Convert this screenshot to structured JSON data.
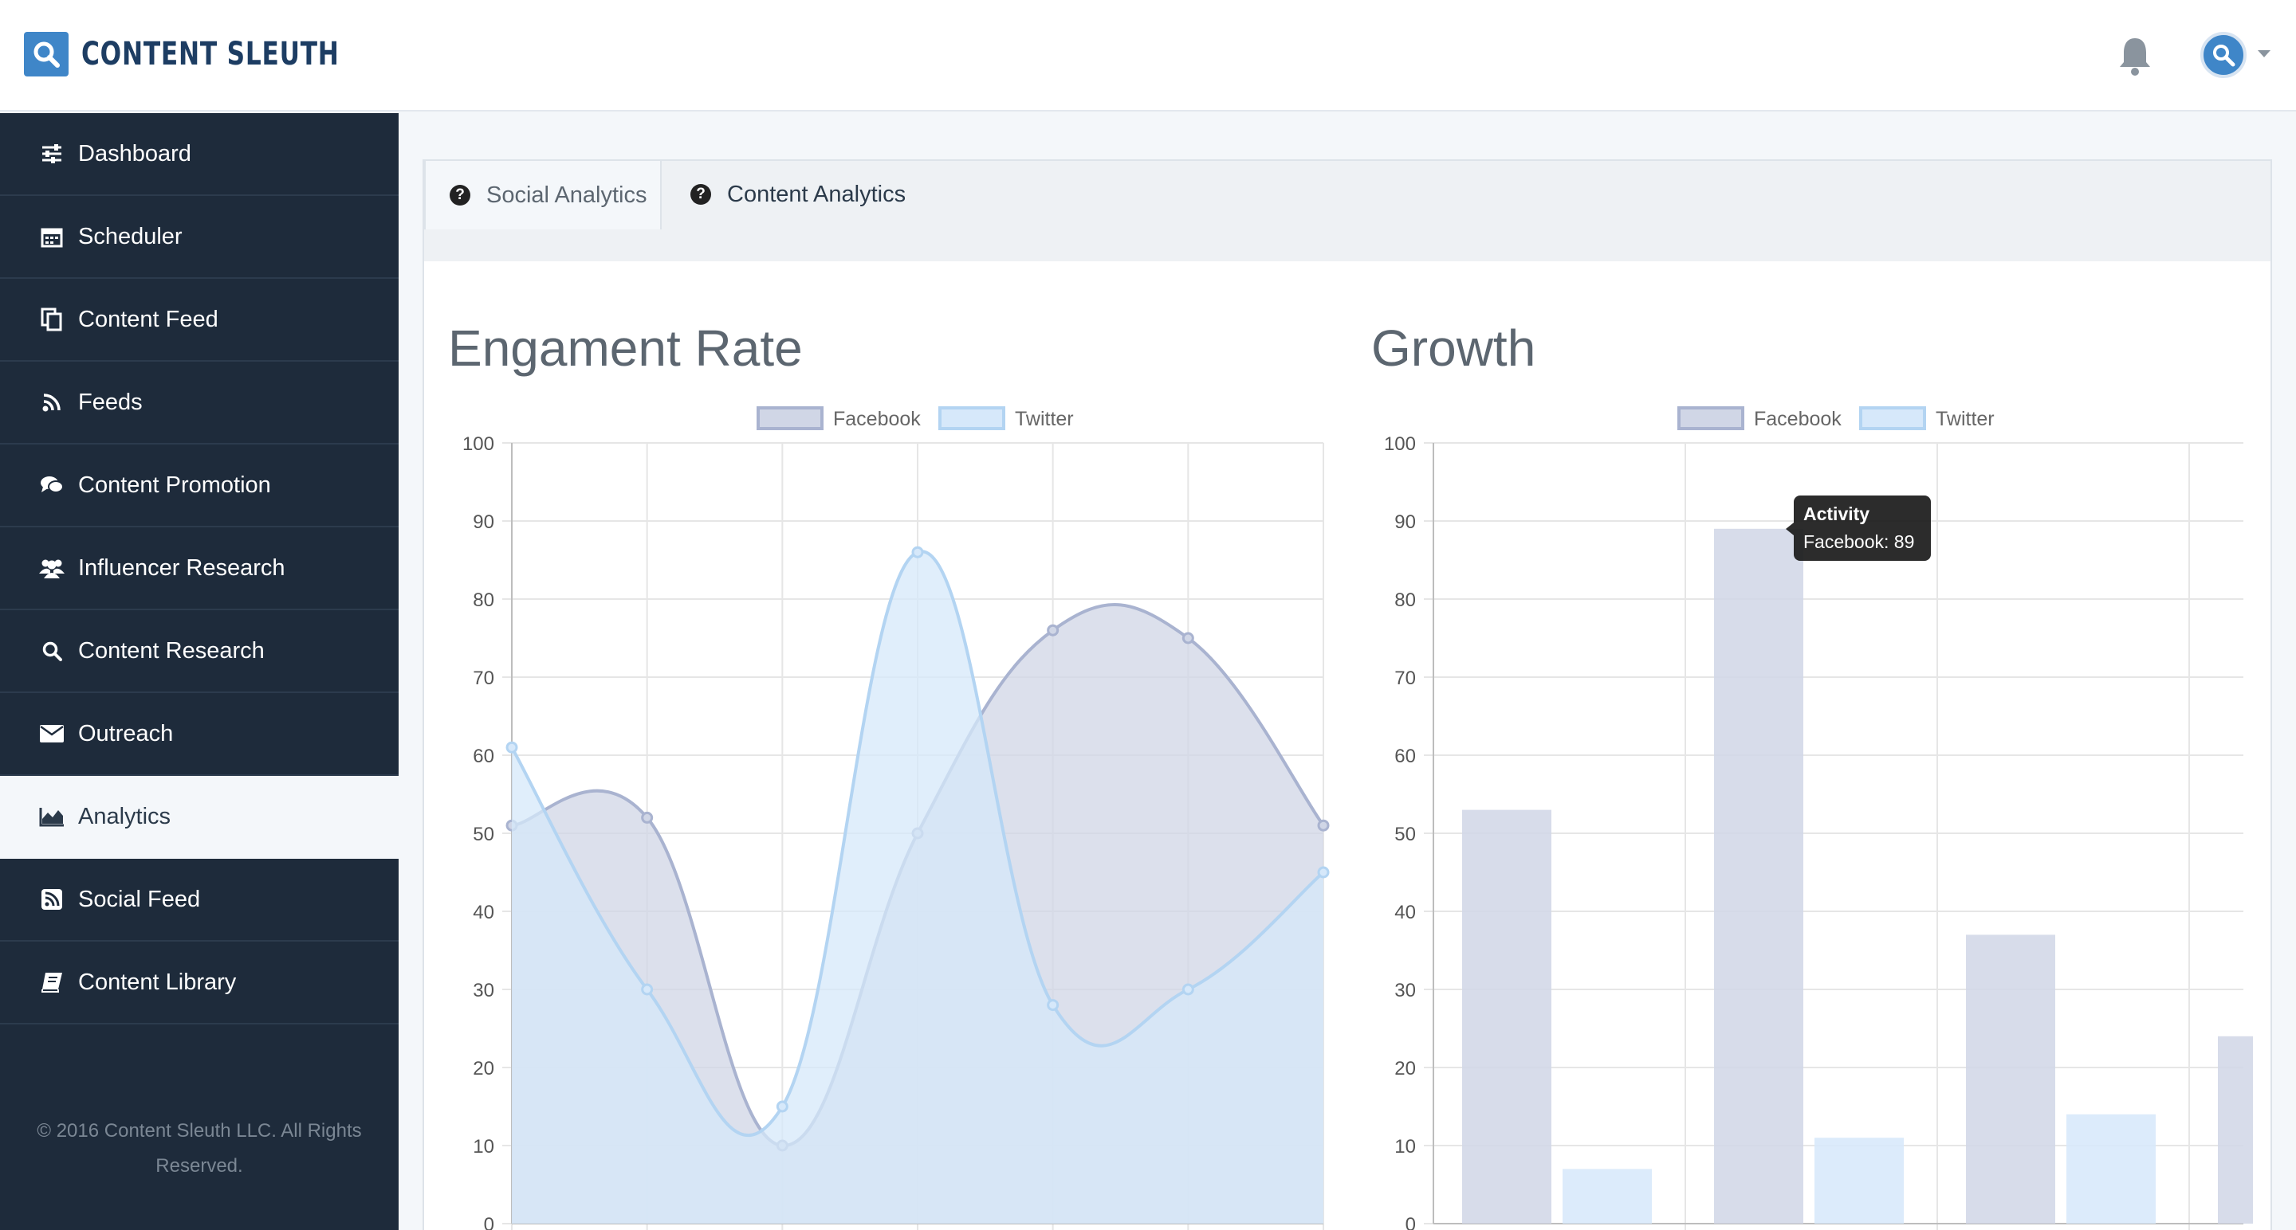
{
  "app": {
    "brand": "CONTENT SLEUTH"
  },
  "header": {
    "bell_icon": "bell-icon",
    "avatar_icon": "search-icon"
  },
  "sidebar": {
    "items": [
      {
        "label": "Dashboard",
        "icon": "sliders-icon"
      },
      {
        "label": "Scheduler",
        "icon": "calendar-icon"
      },
      {
        "label": "Content Feed",
        "icon": "copy-icon"
      },
      {
        "label": "Feeds",
        "icon": "rss-icon"
      },
      {
        "label": "Content Promotion",
        "icon": "comments-icon"
      },
      {
        "label": "Influencer Research",
        "icon": "users-icon"
      },
      {
        "label": "Content Research",
        "icon": "search-icon"
      },
      {
        "label": "Outreach",
        "icon": "envelope-icon"
      },
      {
        "label": "Analytics",
        "icon": "area-chart-icon",
        "active": true
      },
      {
        "label": "Social Feed",
        "icon": "rss-square-icon"
      },
      {
        "label": "Content Library",
        "icon": "book-icon"
      }
    ],
    "footer": "© 2016 Content Sleuth LLC. All Rights Reserved."
  },
  "tabs": [
    {
      "label": "Social Analytics",
      "active": true
    },
    {
      "label": "Content Analytics",
      "active": false
    }
  ],
  "colors": {
    "facebook_fill": "#d0d6e6",
    "facebook_stroke": "#a9b3d0",
    "twitter_fill": "#d6e8fa",
    "twitter_stroke": "#b3d4f2",
    "sidebar_bg": "#1e2b3b",
    "accent": "#3f86c8"
  },
  "chart_data": [
    {
      "type": "line",
      "title": "Engament Rate",
      "yticks": [
        "100",
        "90",
        "80",
        "70",
        "60",
        "50",
        "40",
        "30",
        "20",
        "10",
        "0"
      ],
      "ylim": [
        0,
        100
      ],
      "legend": "top",
      "grid": true,
      "series": [
        {
          "name": "Facebook",
          "values": [
            51,
            52,
            10,
            50,
            76,
            75,
            51
          ]
        },
        {
          "name": "Twitter",
          "values": [
            61,
            30,
            15,
            86,
            28,
            30,
            45
          ]
        }
      ]
    },
    {
      "type": "bar",
      "title": "Growth",
      "yticks": [
        "100",
        "90",
        "80",
        "70",
        "60",
        "50",
        "40",
        "30",
        "20",
        "10",
        "0"
      ],
      "ylim": [
        0,
        100
      ],
      "legend": "top",
      "grid": true,
      "series": [
        {
          "name": "Facebook",
          "values": [
            53,
            89,
            37,
            24
          ]
        },
        {
          "name": "Twitter",
          "values": [
            7,
            11,
            14
          ]
        }
      ],
      "tooltip": {
        "title": "Activity",
        "text": "Facebook: 89"
      }
    }
  ]
}
